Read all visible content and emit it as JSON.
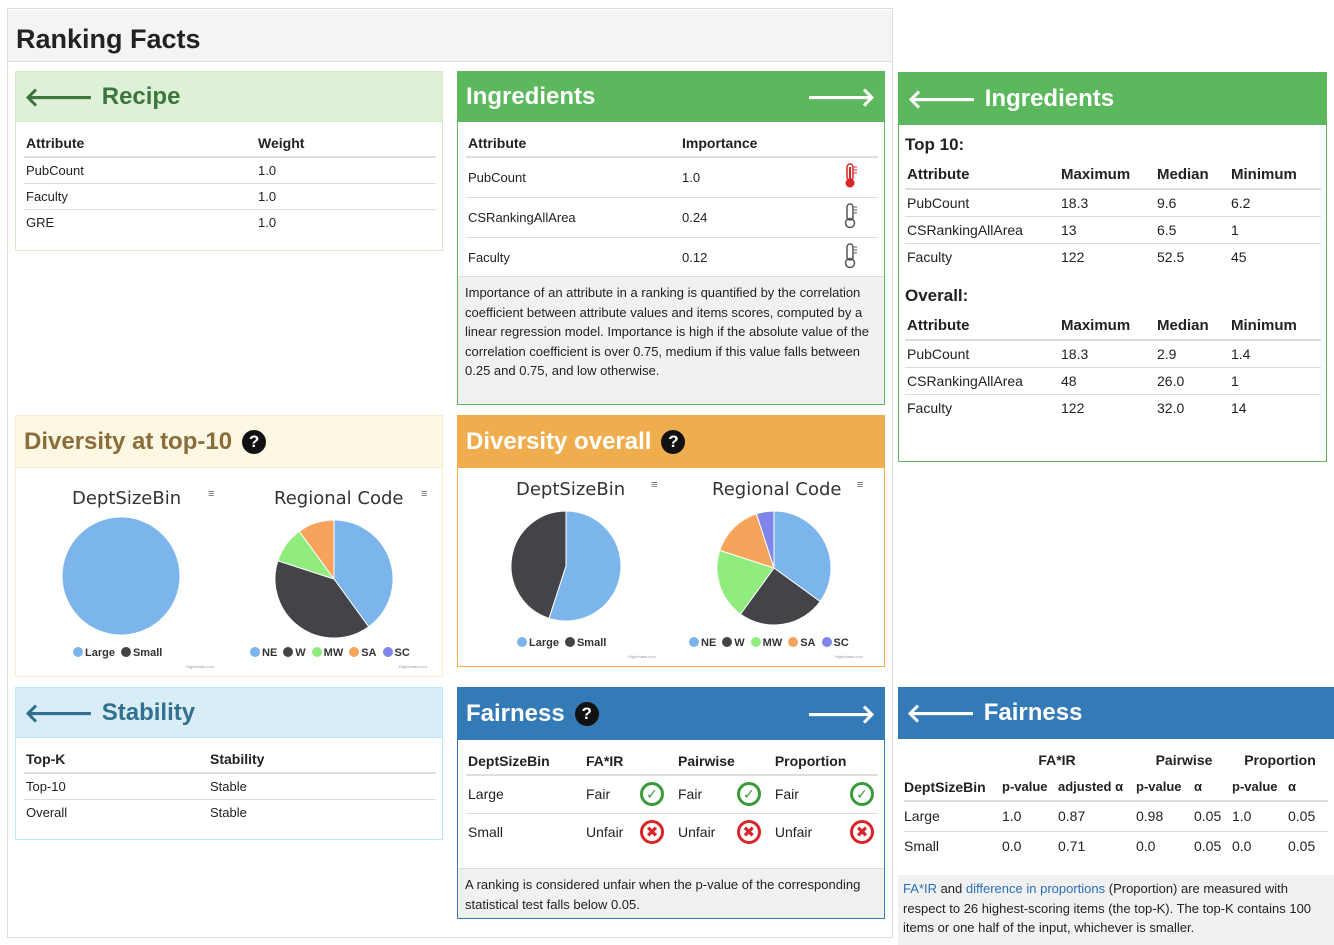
{
  "page_title": "Ranking Facts",
  "recipe": {
    "title": "Recipe",
    "headers": [
      "Attribute",
      "Weight"
    ],
    "rows": [
      [
        "PubCount",
        "1.0"
      ],
      [
        "Faculty",
        "1.0"
      ],
      [
        "GRE",
        "1.0"
      ]
    ]
  },
  "ingredients": {
    "title": "Ingredients",
    "headers": [
      "Attribute",
      "Importance"
    ],
    "rows": [
      {
        "attr": "PubCount",
        "imp": "1.0",
        "level": "high"
      },
      {
        "attr": "CSRankingAllArea",
        "imp": "0.24",
        "level": "low"
      },
      {
        "attr": "Faculty",
        "imp": "0.12",
        "level": "low"
      }
    ],
    "note": "Importance of an attribute in a ranking is quantified by the correlation coefficient between attribute values and items scores, computed by a linear regression model. Importance is high if the absolute value of the correlation coefficient is over 0.75, medium if this value falls between 0.25 and 0.75, and low otherwise."
  },
  "ingredients_detail": {
    "title": "Ingredients",
    "top10_label": "Top 10:",
    "overall_label": "Overall:",
    "headers": [
      "Attribute",
      "Maximum",
      "Median",
      "Minimum"
    ],
    "top10": [
      [
        "PubCount",
        "18.3",
        "9.6",
        "6.2"
      ],
      [
        "CSRankingAllArea",
        "13",
        "6.5",
        "1"
      ],
      [
        "Faculty",
        "122",
        "52.5",
        "45"
      ]
    ],
    "overall": [
      [
        "PubCount",
        "18.3",
        "2.9",
        "1.4"
      ],
      [
        "CSRankingAllArea",
        "48",
        "26.0",
        "1"
      ],
      [
        "Faculty",
        "122",
        "32.0",
        "14"
      ]
    ]
  },
  "diversity_top": {
    "title": "Diversity at top-10",
    "chart1_title": "DeptSizeBin",
    "chart2_title": "Regional Code",
    "menu_glyph": "≡",
    "credit": "Highcharts.com"
  },
  "diversity_overall": {
    "title": "Diversity overall",
    "chart1_title": "DeptSizeBin",
    "chart2_title": "Regional Code",
    "menu_glyph": "≡",
    "credit": "Highcharts.com"
  },
  "stability": {
    "title": "Stability",
    "headers": [
      "Top-K",
      "Stability"
    ],
    "rows": [
      [
        "Top-10",
        "Stable"
      ],
      [
        "Overall",
        "Stable"
      ]
    ]
  },
  "fairness": {
    "title": "Fairness",
    "headers": [
      "DeptSizeBin",
      "FA*IR",
      "Pairwise",
      "Proportion"
    ],
    "rows": [
      {
        "group": "Large",
        "fair": "Fair",
        "pair": "Fair",
        "prop": "Fair",
        "ok": true
      },
      {
        "group": "Small",
        "fair": "Unfair",
        "pair": "Unfair",
        "prop": "Unfair",
        "ok": false
      }
    ],
    "note": "A ranking is considered unfair when the p-value of the corresponding statistical test falls below 0.05."
  },
  "fairness_detail": {
    "title": "Fairness",
    "group_headers": [
      "FA*IR",
      "Pairwise",
      "Proportion"
    ],
    "headers": [
      "DeptSizeBin",
      "p-value",
      "adjusted α",
      "p-value",
      "α",
      "p-value",
      "α"
    ],
    "rows": [
      [
        "Large",
        "1.0",
        "0.87",
        "0.98",
        "0.05",
        "1.0",
        "0.05"
      ],
      [
        "Small",
        "0.0",
        "0.71",
        "0.0",
        "0.05",
        "0.0",
        "0.05"
      ]
    ],
    "note_link1": "FA*IR",
    "note_and": " and ",
    "note_link2": "difference in proportions",
    "note_rest": " (Proportion) are measured with respect to 26 highest-scoring items (the top-K). The top-K contains 100 items or one half of the input, whichever is smaller."
  },
  "chart_data": [
    {
      "type": "pie",
      "title": "DeptSizeBin",
      "group": "Diversity at top-10",
      "categories": [
        "Large",
        "Small"
      ],
      "values": [
        100,
        0
      ],
      "colors": [
        "#7cb5ec",
        "#434348"
      ]
    },
    {
      "type": "pie",
      "title": "Regional Code",
      "group": "Diversity at top-10",
      "categories": [
        "NE",
        "W",
        "MW",
        "SA",
        "SC"
      ],
      "values": [
        40,
        40,
        10,
        10,
        0
      ],
      "colors": [
        "#7cb5ec",
        "#434348",
        "#90ed7d",
        "#f7a35c",
        "#8085e9"
      ]
    },
    {
      "type": "pie",
      "title": "DeptSizeBin",
      "group": "Diversity overall",
      "categories": [
        "Large",
        "Small"
      ],
      "values": [
        55,
        45
      ],
      "colors": [
        "#7cb5ec",
        "#434348"
      ]
    },
    {
      "type": "pie",
      "title": "Regional Code",
      "group": "Diversity overall",
      "categories": [
        "NE",
        "W",
        "MW",
        "SA",
        "SC"
      ],
      "values": [
        35,
        25,
        20,
        15,
        5
      ],
      "colors": [
        "#7cb5ec",
        "#434348",
        "#90ed7d",
        "#f7a35c",
        "#8085e9"
      ]
    }
  ]
}
